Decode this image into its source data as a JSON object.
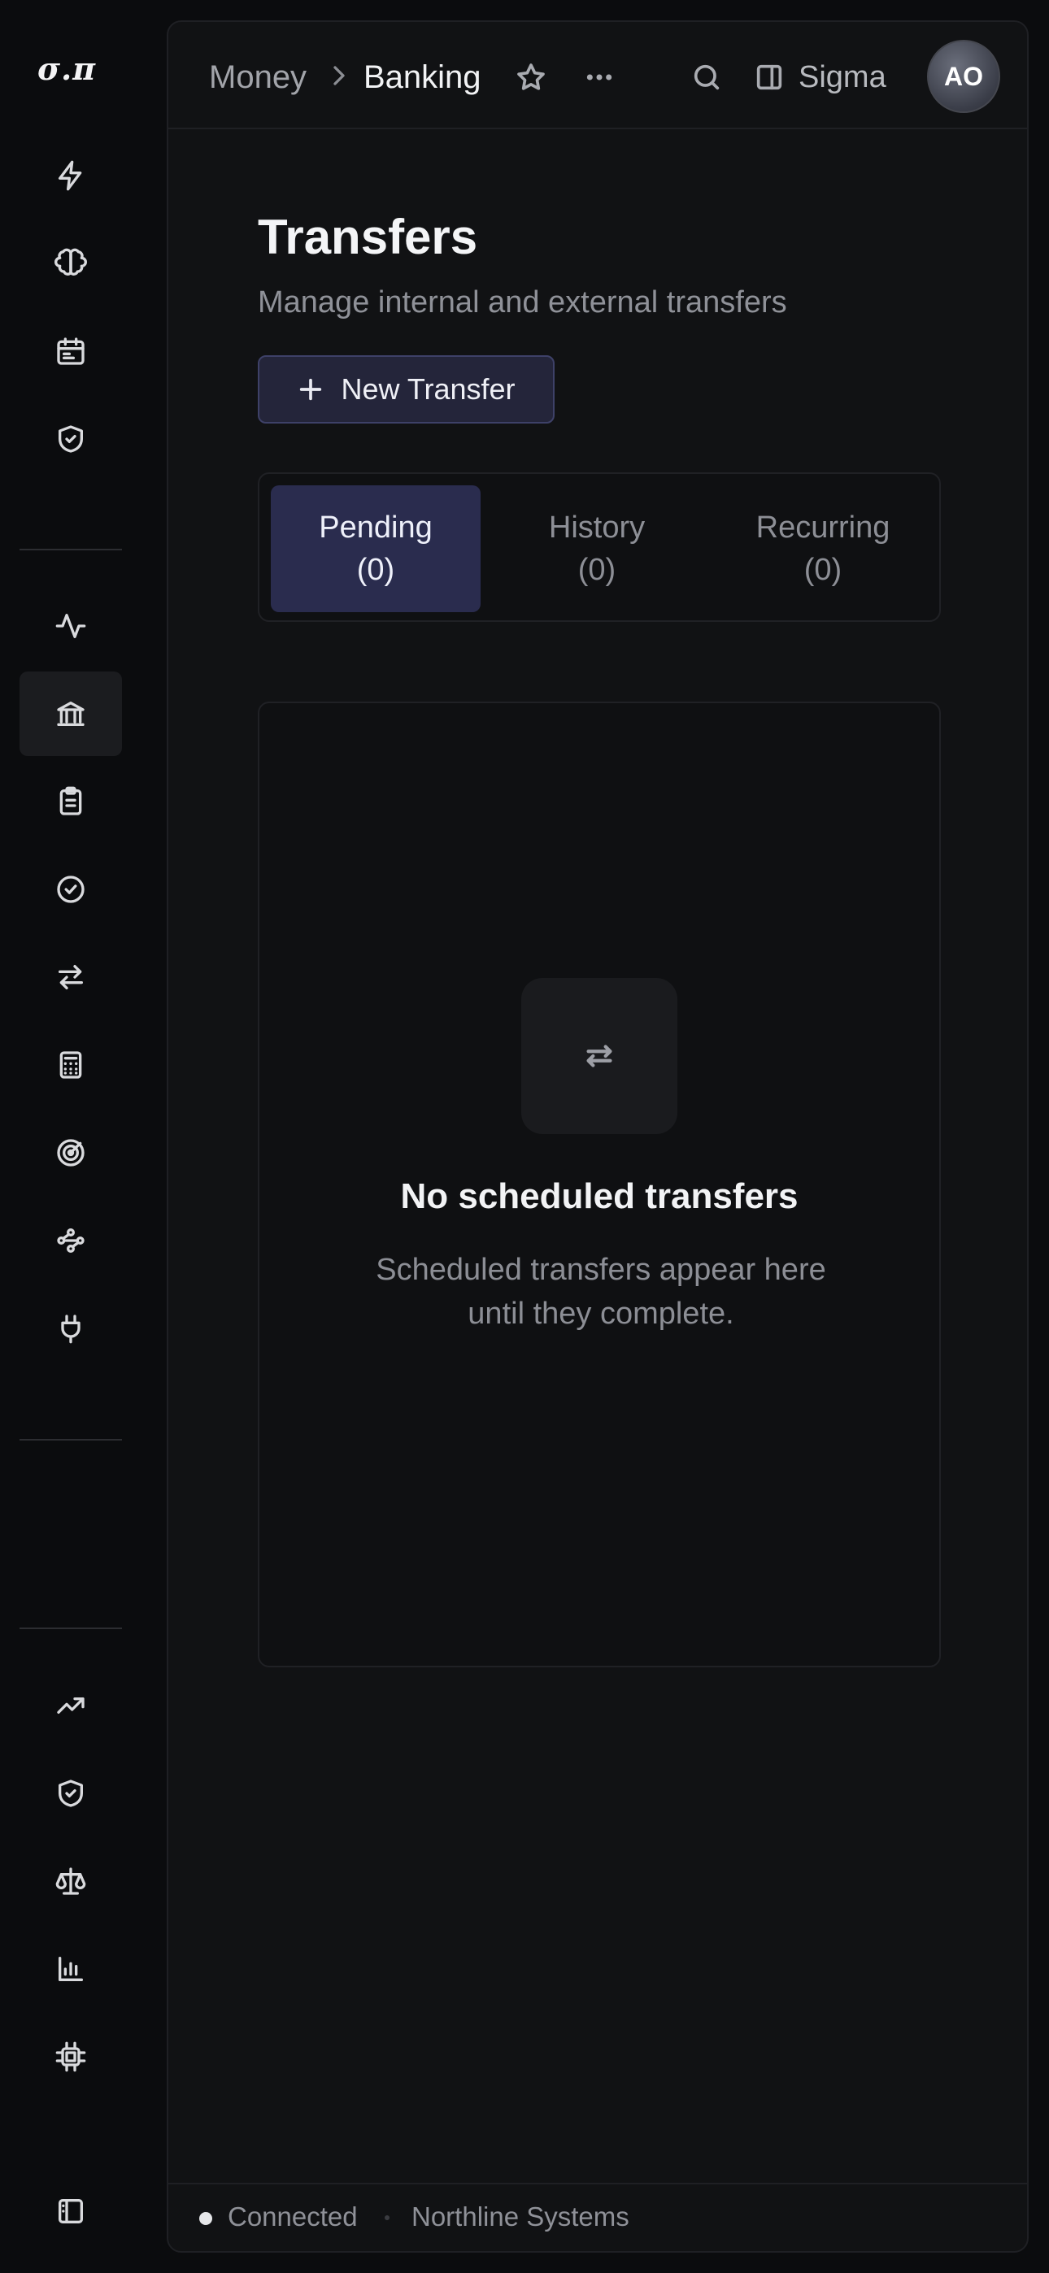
{
  "brand": {
    "logo_text": "σ.π"
  },
  "sidebar": {
    "groups": [
      [
        "lightning-icon",
        "brain-icon",
        "calendar-icon",
        "shield-check-icon"
      ],
      [
        "activity-icon",
        "bank-icon",
        "clipboard-icon",
        "badge-check-icon",
        "arrows-exchange-icon",
        "calculator-icon",
        "target-icon",
        "workflow-icon",
        "plug-icon"
      ],
      [
        "trending-up-icon",
        "shield-check-icon",
        "scale-icon",
        "bar-chart-icon",
        "chip-icon"
      ]
    ],
    "active": "bank-icon",
    "footer_icon": "panel-toggle-icon"
  },
  "topbar": {
    "breadcrumb": [
      "Money",
      "Banking"
    ],
    "workspace_label": "Sigma",
    "avatar_initials": "AO"
  },
  "page": {
    "title": "Transfers",
    "subtitle": "Manage internal and external transfers",
    "new_button_label": "New Transfer"
  },
  "tabs": [
    {
      "label": "Pending",
      "count": "(0)",
      "active": true
    },
    {
      "label": "History",
      "count": "(0)",
      "active": false
    },
    {
      "label": "Recurring",
      "count": "(0)",
      "active": false
    }
  ],
  "empty_state": {
    "icon": "arrows-exchange-icon",
    "title": "No scheduled transfers",
    "description": "Scheduled transfers appear here until they complete."
  },
  "status": {
    "connection": "Connected",
    "organization": "Northline Systems"
  }
}
